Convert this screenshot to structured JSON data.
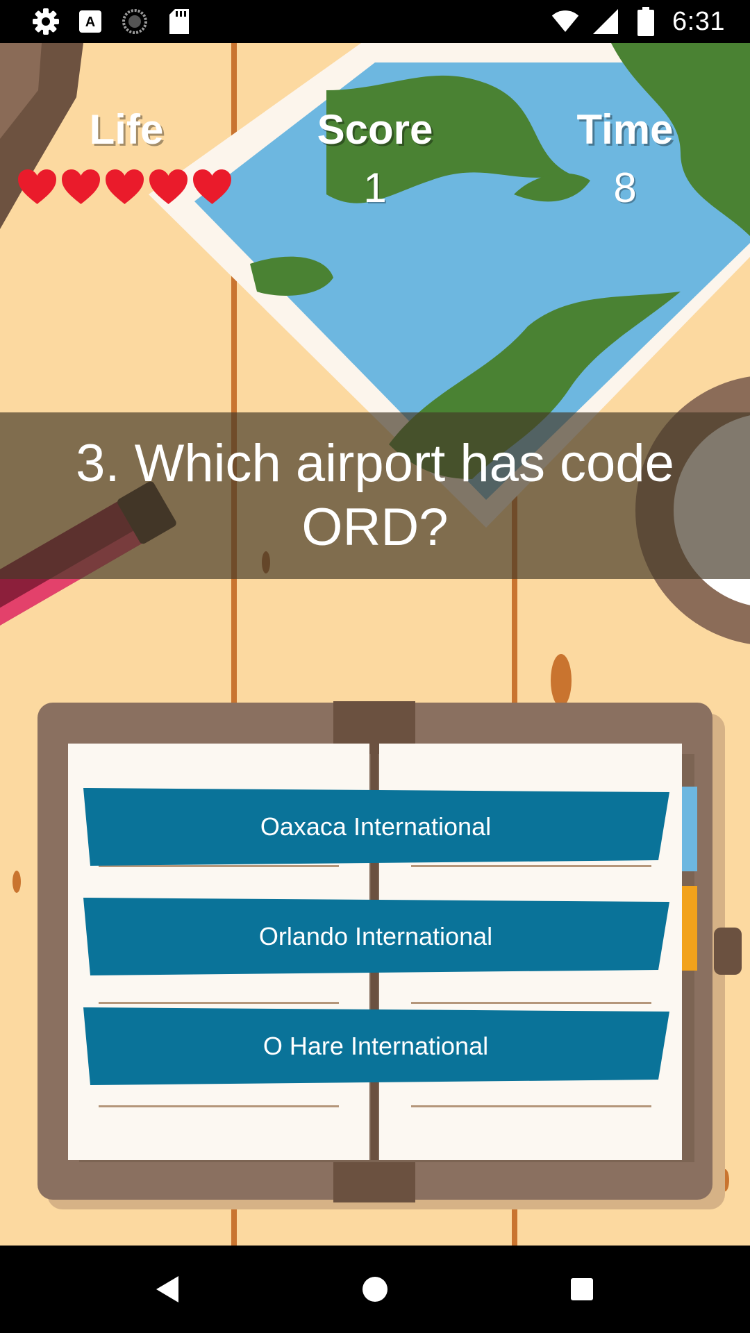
{
  "status_bar": {
    "time": "6:31",
    "icons": [
      "gear-icon",
      "keyboard-a-icon",
      "loading-spinner-icon",
      "sd-card-icon",
      "wifi-icon",
      "cell-signal-icon",
      "battery-icon"
    ]
  },
  "hud": {
    "life_label": "Life",
    "lives": 5,
    "score_label": "Score",
    "score_value": "1",
    "time_label": "Time",
    "time_value": "8"
  },
  "question": {
    "text": "3. Which airport has code ORD?"
  },
  "answers": [
    {
      "label": "Oaxaca International"
    },
    {
      "label": "Orlando International"
    },
    {
      "label": "O Hare International"
    }
  ],
  "nav_bar": {
    "icons": [
      "back-icon",
      "home-icon",
      "recents-icon"
    ]
  },
  "colors": {
    "background": "#fcd9a0",
    "answer_button": "#0a7399",
    "heart": "#ea1b2b",
    "map_water": "#6db7e0",
    "map_land": "#4a8233",
    "question_band": "#463a28"
  }
}
